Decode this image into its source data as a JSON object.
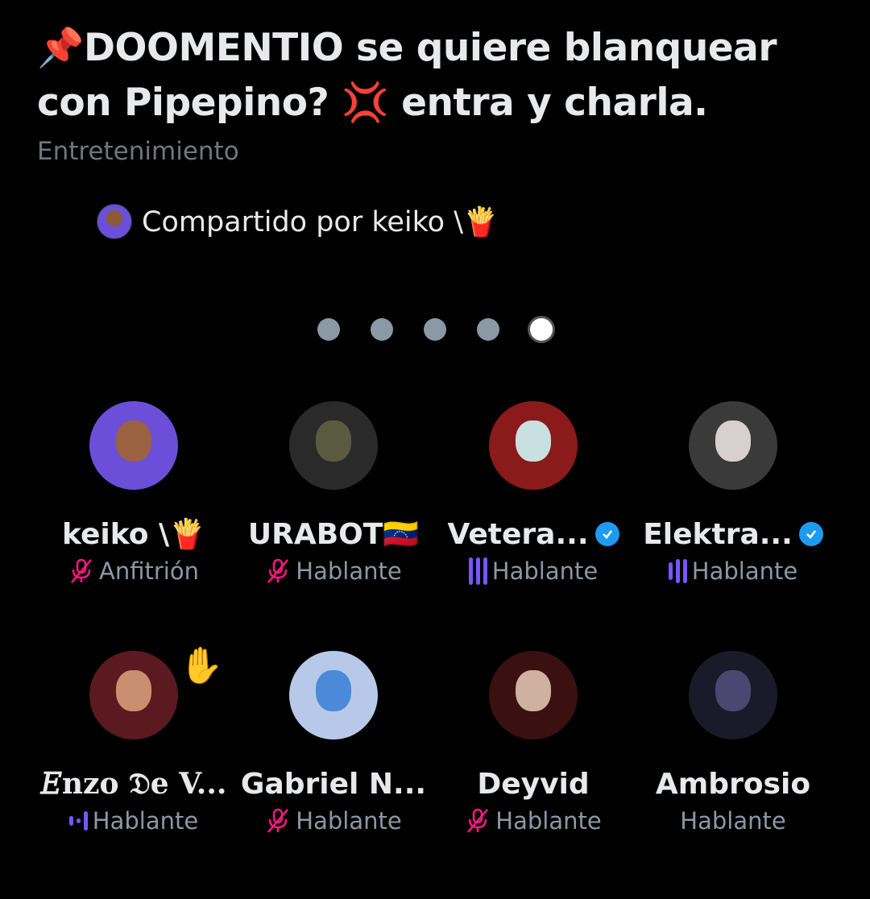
{
  "space": {
    "title": "📌DOOMENTIO se quiere blanquear con Pipepino? 💢 entra y charla.",
    "category": "Entretenimiento",
    "shared_by": "Compartido por keiko \\🍟"
  },
  "pagination": {
    "total": 5,
    "active": 5
  },
  "participants": [
    {
      "name": "keiko \\🍟",
      "role": "Anfitrión",
      "status": "muted",
      "verified": false,
      "avatar_color": "#6b4fd8"
    },
    {
      "name": "URABOT🇻🇪",
      "role": "Hablante",
      "status": "muted",
      "verified": false,
      "avatar_color": "#2a2a2a"
    },
    {
      "name": "Vetera...",
      "role": "Hablante",
      "status": "speaking",
      "verified": true,
      "avatar_color": "#8b1a1a"
    },
    {
      "name": "Elektra...",
      "role": "Hablante",
      "status": "speaking",
      "verified": true,
      "avatar_color": "#3a3a3a"
    },
    {
      "name": "𝐸nzo 𝔇e V...",
      "role": "Hablante",
      "status": "speaking",
      "verified": false,
      "avatar_color": "#5a1a20",
      "hand_raised": true
    },
    {
      "name": "Gabriel N...",
      "role": "Hablante",
      "status": "muted",
      "verified": false,
      "avatar_color": "#b8c8e8"
    },
    {
      "name": "Deyvid",
      "role": "Hablante",
      "status": "muted",
      "verified": false,
      "avatar_color": "#3a1010"
    },
    {
      "name": "Ambrosio",
      "role": "Hablante",
      "status": "listening",
      "verified": false,
      "avatar_color": "#1a1a2a"
    }
  ],
  "colors": {
    "muted": "#f91880",
    "speaking": "#7856ff",
    "verified": "#1d9bf0"
  }
}
